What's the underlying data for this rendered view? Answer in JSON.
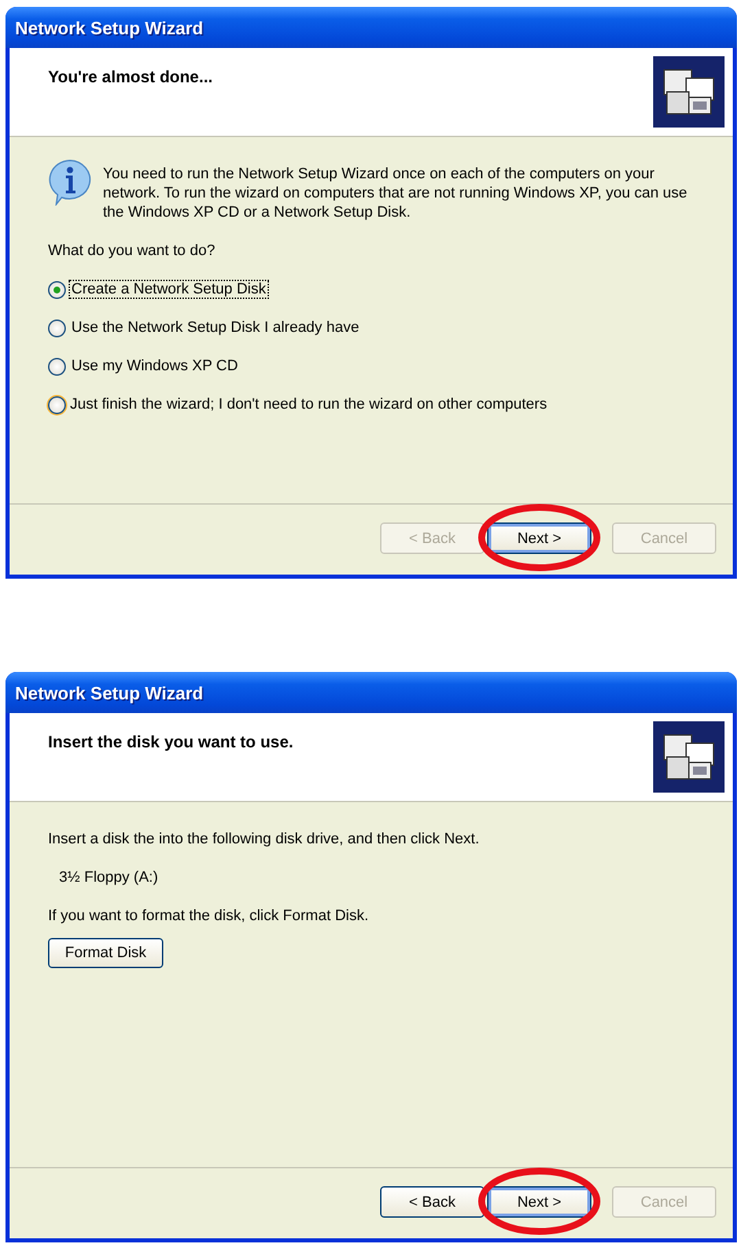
{
  "dialogs": [
    {
      "title": "Network Setup Wizard",
      "heading": "You're almost done...",
      "body": [
        {
          "kind": "info",
          "text": "You need to run the Network Setup Wizard once on each of the computers on your network. To run the wizard on computers that are not running Windows XP, you can use the Windows XP CD or a Network Setup Disk."
        },
        {
          "kind": "text",
          "text": "What do you want to do?"
        },
        {
          "kind": "radio",
          "label": "Create a Network Setup Disk",
          "selected": true,
          "hovered": false,
          "focused": true
        },
        {
          "kind": "radio",
          "label": "Use the Network Setup Disk I already have",
          "selected": false,
          "hovered": false,
          "focused": false
        },
        {
          "kind": "radio",
          "label": "Use my Windows XP CD",
          "selected": false,
          "hovered": false,
          "focused": false
        },
        {
          "kind": "radio",
          "label": "Just finish the wizard; I don't need to run the wizard on other computers",
          "selected": false,
          "hovered": true,
          "focused": false
        }
      ],
      "buttons": [
        {
          "label": "< Back",
          "disabled": true,
          "default": false,
          "circled": false
        },
        {
          "label": "Next >",
          "disabled": false,
          "default": true,
          "circled": true
        },
        {
          "label": "Cancel",
          "disabled": true,
          "default": false,
          "circled": false
        }
      ]
    },
    {
      "title": "Network Setup Wizard",
      "heading": "Insert the disk you want to use.",
      "body": [
        {
          "kind": "text",
          "text": "Insert a disk the into the following disk drive, and then click Next."
        },
        {
          "kind": "indented",
          "text": "3½ Floppy (A:)"
        },
        {
          "kind": "text",
          "text": "If you want to format the disk, click Format Disk."
        },
        {
          "kind": "button",
          "label": "Format Disk"
        }
      ],
      "buttons": [
        {
          "label": "< Back",
          "disabled": false,
          "default": false,
          "circled": false
        },
        {
          "label": "Next >",
          "disabled": false,
          "default": true,
          "circled": true
        },
        {
          "label": "Cancel",
          "disabled": true,
          "default": false,
          "circled": false
        }
      ]
    }
  ]
}
